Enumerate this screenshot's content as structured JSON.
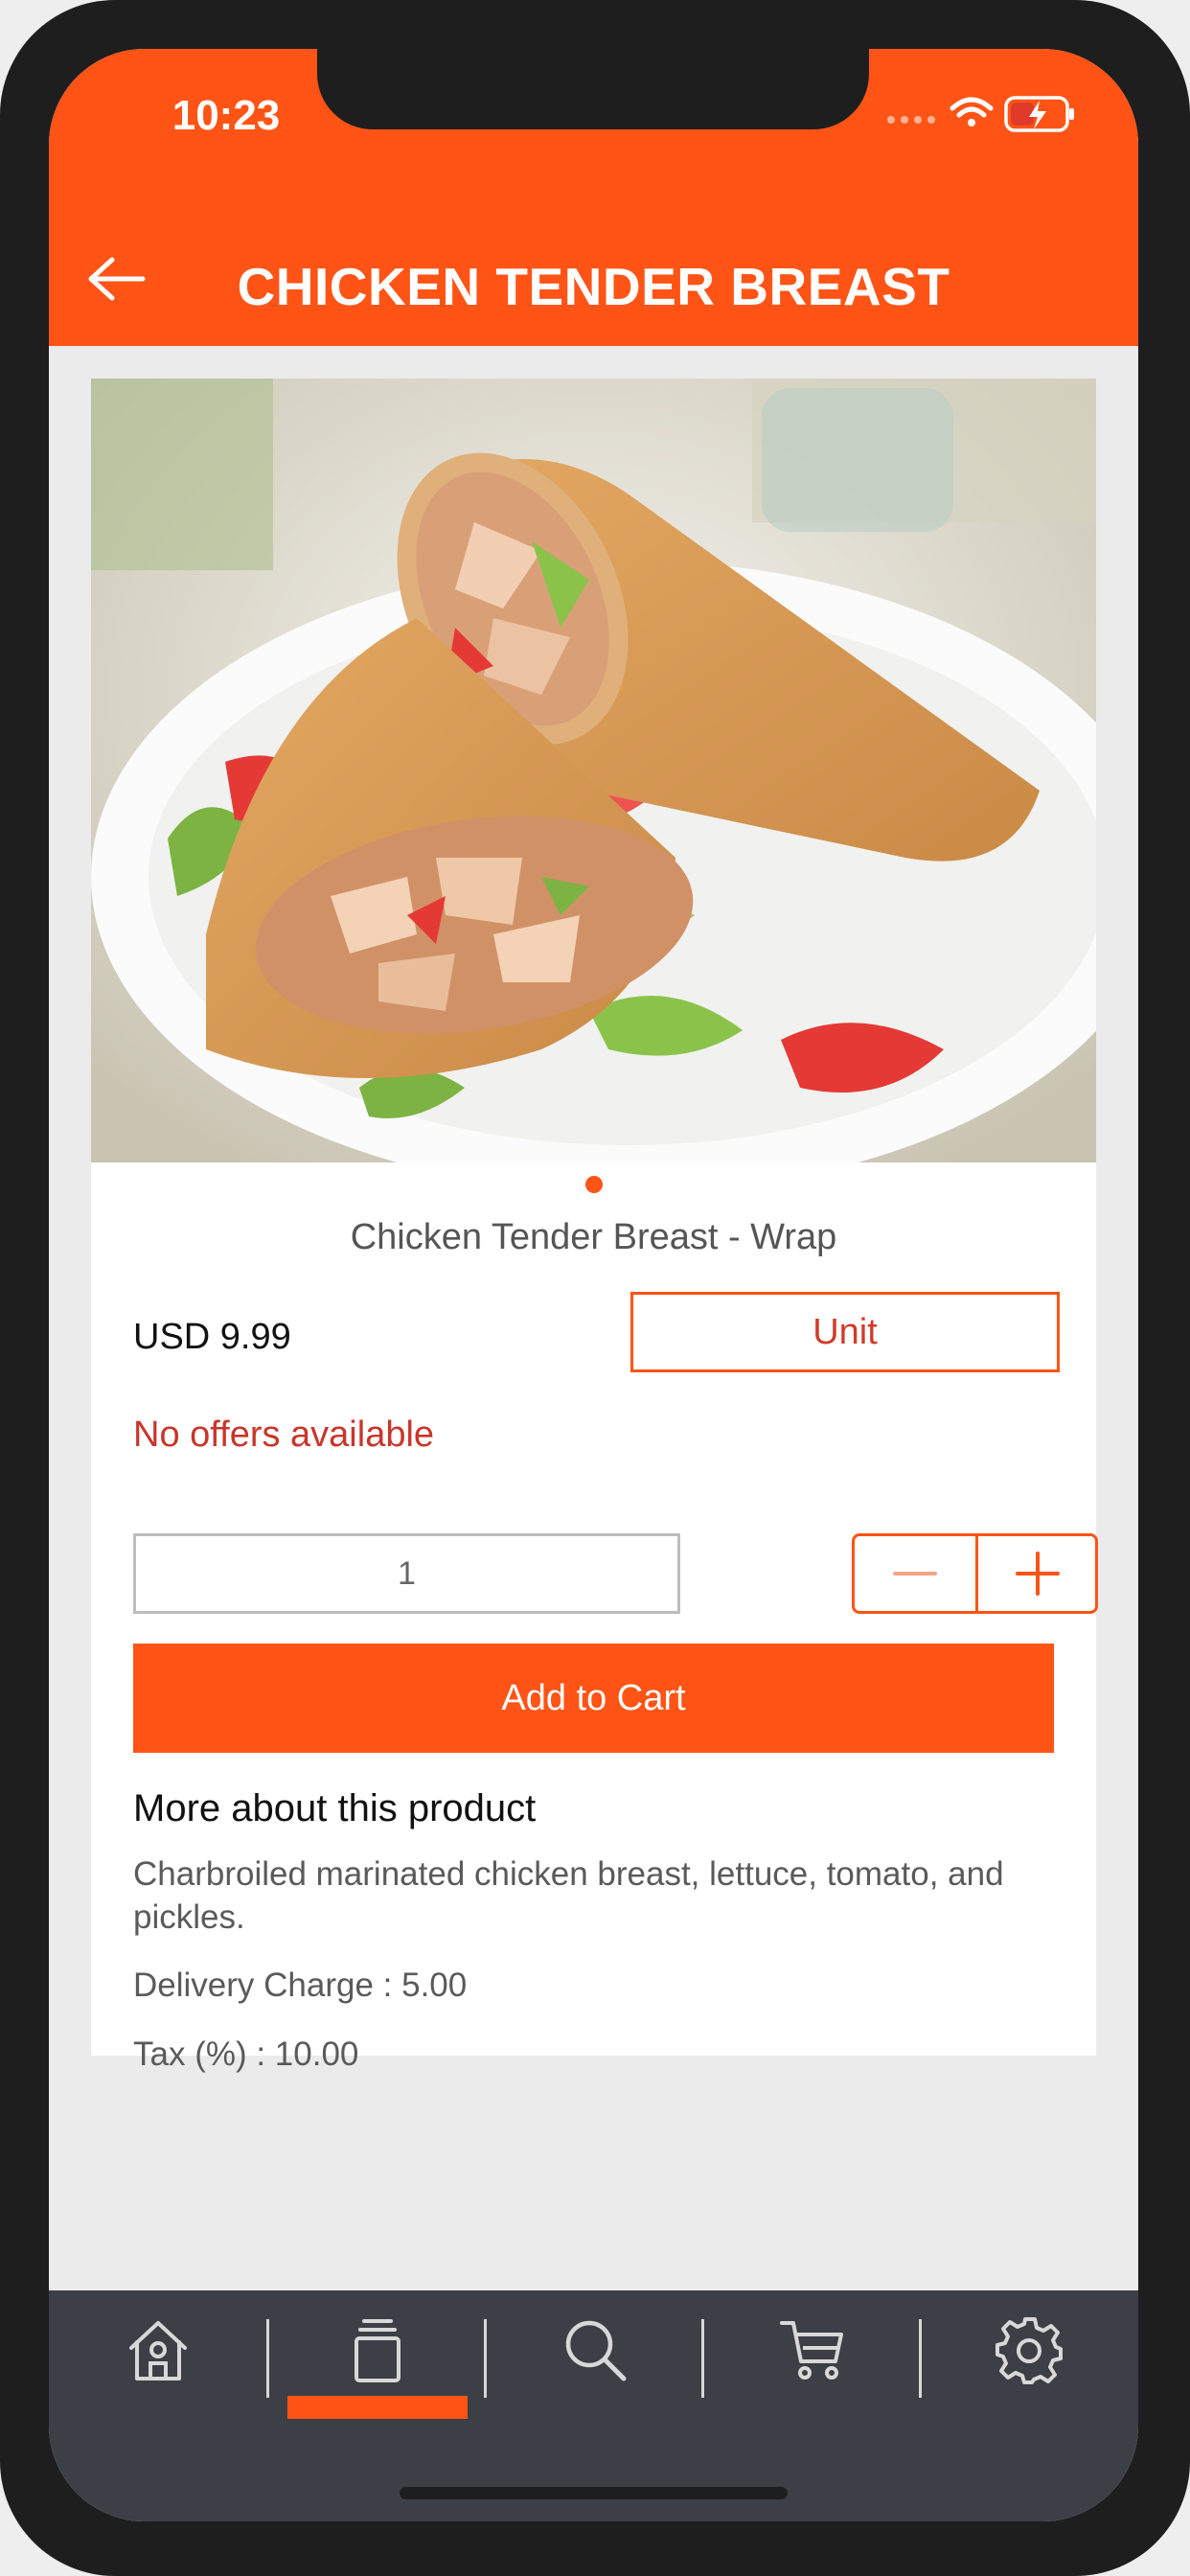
{
  "status_bar": {
    "time": "10:23"
  },
  "header": {
    "title": "CHICKEN TENDER BREAST",
    "back_icon": "arrow-left-icon"
  },
  "product": {
    "name": "Chicken Tender Breast - Wrap",
    "price": "USD 9.99",
    "unit_label": "Unit",
    "offers": "No offers available",
    "quantity": "1",
    "add_to_cart": "Add to Cart",
    "more_title": "More about this product",
    "description": "Charbroiled marinated chicken breast, lettuce, tomato, and pickles.",
    "delivery": "Delivery Charge : 5.00",
    "tax": "Tax (%) : 10.00"
  },
  "nav": {
    "items": [
      {
        "icon": "home-icon"
      },
      {
        "icon": "catalog-icon",
        "active": true
      },
      {
        "icon": "search-icon"
      },
      {
        "icon": "cart-icon"
      },
      {
        "icon": "gear-icon"
      }
    ]
  },
  "colors": {
    "accent": "#ff5416",
    "nav_background": "#3c3f45",
    "offer_text": "#c8362c"
  }
}
